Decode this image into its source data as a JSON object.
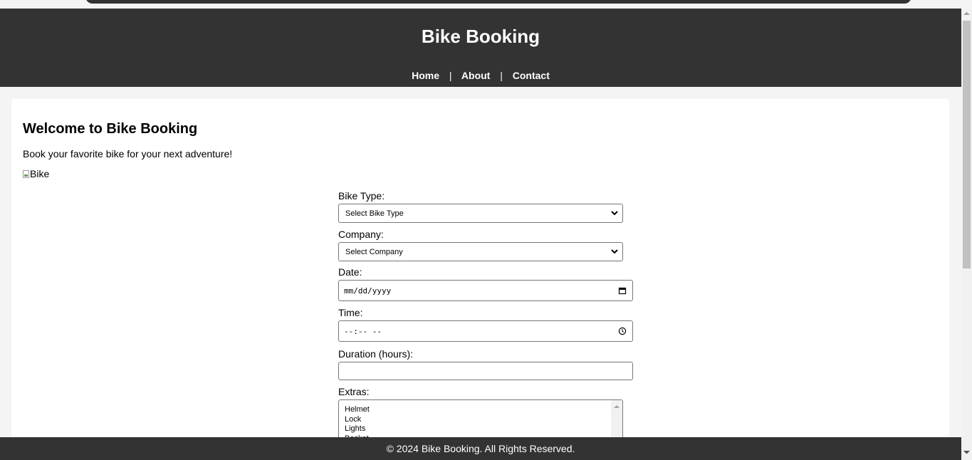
{
  "header": {
    "title": "Bike Booking",
    "nav": [
      {
        "label": "Home"
      },
      {
        "label": "About"
      },
      {
        "label": "Contact"
      }
    ],
    "separator": "|"
  },
  "main": {
    "heading": "Welcome to Bike Booking",
    "intro": "Book your favorite bike for your next adventure!",
    "image_alt": "Bike"
  },
  "form": {
    "bike_type": {
      "label": "Bike Type:",
      "selected": "Select Bike Type"
    },
    "company": {
      "label": "Company:",
      "selected": "Select Company"
    },
    "date": {
      "label": "Date:",
      "placeholder": "mm/dd/yyyy"
    },
    "time": {
      "label": "Time:",
      "placeholder": "--:-- --"
    },
    "duration": {
      "label": "Duration (hours):",
      "value": ""
    },
    "extras": {
      "label": "Extras:",
      "options": [
        "Helmet",
        "Lock",
        "Lights",
        "Basket"
      ]
    }
  },
  "footer": {
    "text": "© 2024 Bike Booking. All Rights Reserved."
  },
  "colors": {
    "header_bg": "#333333",
    "page_bg": "#f4f4f4",
    "card_bg": "#ffffff"
  }
}
